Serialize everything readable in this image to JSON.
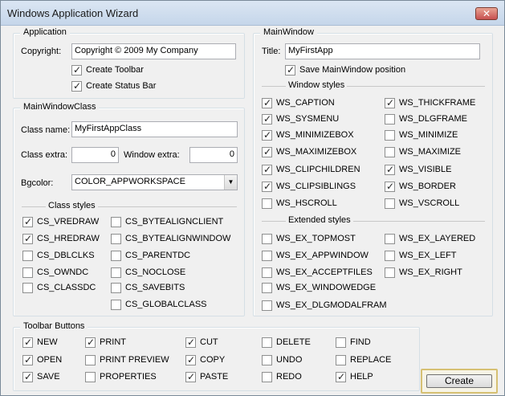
{
  "window": {
    "title": "Windows Application Wizard",
    "close_glyph": "✕"
  },
  "application": {
    "legend": "Application",
    "copyright_label": "Copyright:",
    "copyright_value": "Copyright © 2009 My Company",
    "create_toolbar": {
      "label": "Create Toolbar",
      "checked": true
    },
    "create_statusbar": {
      "label": "Create Status Bar",
      "checked": true
    }
  },
  "mainwindowclass": {
    "legend": "MainWindowClass",
    "classname_label": "Class name:",
    "classname_value": "MyFirstAppClass",
    "classextra_label": "Class extra:",
    "classextra_value": "0",
    "windowextra_label": "Window extra:",
    "windowextra_value": "0",
    "bgcolor_label": "Bgcolor:",
    "bgcolor_value": "COLOR_APPWORKSPACE",
    "class_styles_label": "Class styles",
    "styles": [
      {
        "label": "CS_VREDRAW",
        "checked": true
      },
      {
        "label": "CS_HREDRAW",
        "checked": true
      },
      {
        "label": "CS_DBLCLKS",
        "checked": false
      },
      {
        "label": "CS_OWNDC",
        "checked": false
      },
      {
        "label": "CS_CLASSDC",
        "checked": false
      },
      {
        "label": "CS_BYTEALIGNCLIENT",
        "checked": false
      },
      {
        "label": "CS_BYTEALIGNWINDOW",
        "checked": false
      },
      {
        "label": "CS_PARENTDC",
        "checked": false
      },
      {
        "label": "CS_NOCLOSE",
        "checked": false
      },
      {
        "label": "CS_SAVEBITS",
        "checked": false
      },
      {
        "label": "CS_GLOBALCLASS",
        "checked": false
      }
    ]
  },
  "mainwindow": {
    "legend": "MainWindow",
    "title_label": "Title:",
    "title_value": "MyFirstApp",
    "save_position": {
      "label": "Save MainWindow position",
      "checked": true
    },
    "window_styles_label": "Window styles",
    "window_styles": [
      {
        "label": "WS_CAPTION",
        "checked": true
      },
      {
        "label": "WS_SYSMENU",
        "checked": true
      },
      {
        "label": "WS_MINIMIZEBOX",
        "checked": true
      },
      {
        "label": "WS_MAXIMIZEBOX",
        "checked": true
      },
      {
        "label": "WS_CLIPCHILDREN",
        "checked": true
      },
      {
        "label": "WS_CLIPSIBLINGS",
        "checked": true
      },
      {
        "label": "WS_HSCROLL",
        "checked": false
      },
      {
        "label": "WS_THICKFRAME",
        "checked": true
      },
      {
        "label": "WS_DLGFRAME",
        "checked": false
      },
      {
        "label": "WS_MINIMIZE",
        "checked": false
      },
      {
        "label": "WS_MAXIMIZE",
        "checked": false
      },
      {
        "label": "WS_VISIBLE",
        "checked": true
      },
      {
        "label": "WS_BORDER",
        "checked": true
      },
      {
        "label": "WS_VSCROLL",
        "checked": false
      }
    ],
    "extended_styles_label": "Extended styles",
    "extended_styles": [
      {
        "label": "WS_EX_TOPMOST",
        "checked": false
      },
      {
        "label": "WS_EX_APPWINDOW",
        "checked": false
      },
      {
        "label": "WS_EX_ACCEPTFILES",
        "checked": false
      },
      {
        "label": "WS_EX_WINDOWEDGE",
        "checked": false
      },
      {
        "label": "WS_EX_DLGMODALFRAM",
        "checked": false
      },
      {
        "label": "WS_EX_LAYERED",
        "checked": false
      },
      {
        "label": "WS_EX_LEFT",
        "checked": false
      },
      {
        "label": "WS_EX_RIGHT",
        "checked": false
      }
    ]
  },
  "toolbar_buttons": {
    "legend": "Toolbar Buttons",
    "items": [
      {
        "label": "NEW",
        "checked": true
      },
      {
        "label": "OPEN",
        "checked": true
      },
      {
        "label": "SAVE",
        "checked": true
      },
      {
        "label": "PRINT",
        "checked": true
      },
      {
        "label": "PRINT PREVIEW",
        "checked": false
      },
      {
        "label": "PROPERTIES",
        "checked": false
      },
      {
        "label": "CUT",
        "checked": true
      },
      {
        "label": "COPY",
        "checked": true
      },
      {
        "label": "PASTE",
        "checked": true
      },
      {
        "label": "DELETE",
        "checked": false
      },
      {
        "label": "UNDO",
        "checked": false
      },
      {
        "label": "REDO",
        "checked": false
      },
      {
        "label": "FIND",
        "checked": false
      },
      {
        "label": "REPLACE",
        "checked": false
      },
      {
        "label": "HELP",
        "checked": true
      }
    ]
  },
  "create_button": {
    "label": "Create"
  },
  "check_glyph": "✓",
  "combo_arrow_glyph": "▼"
}
